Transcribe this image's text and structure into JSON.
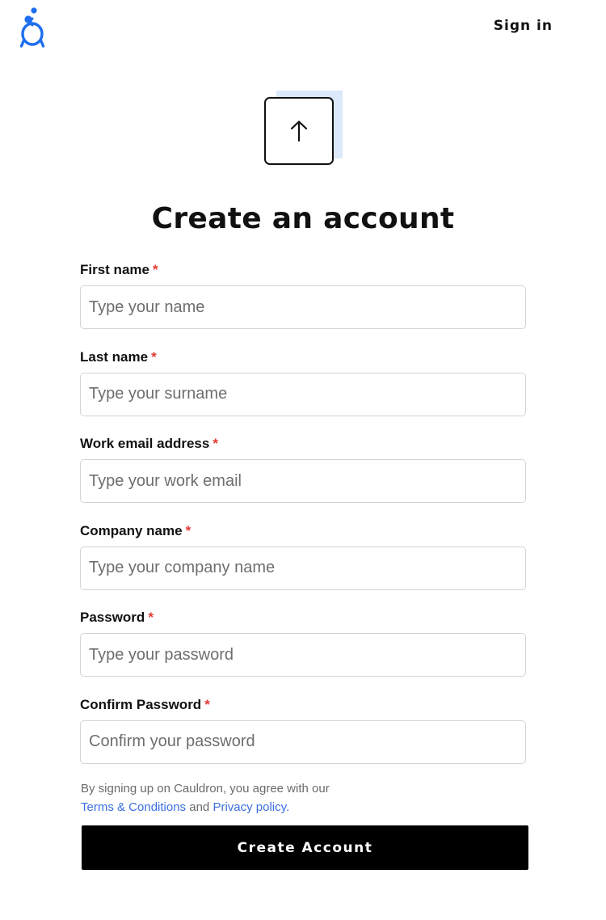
{
  "header": {
    "logo_icon": "cauldron-logo-icon",
    "brand_color": "#1e6ff0",
    "sign_in_label": "Sign in"
  },
  "upload": {
    "icon": "arrow-up-icon"
  },
  "page_title": "Create an account",
  "form": {
    "required_marker": "*",
    "required_color": "#e53935",
    "fields": [
      {
        "label": "First name",
        "placeholder": "Type your name",
        "value": ""
      },
      {
        "label": "Last name",
        "placeholder": "Type your surname",
        "value": ""
      },
      {
        "label": "Work email address",
        "placeholder": "Type your work email",
        "value": ""
      },
      {
        "label": "Company name",
        "placeholder": "Type your company name",
        "value": ""
      },
      {
        "label": "Password",
        "placeholder": "Type your password",
        "value": ""
      },
      {
        "label": "Confirm Password",
        "placeholder": "Confirm your password",
        "value": ""
      }
    ]
  },
  "terms": {
    "prefix": "By signing up on Cauldron, you agree with our",
    "terms_link": "Terms & Conditions",
    "conjunction": "and",
    "privacy_link": "Privacy policy.",
    "link_color": "#3b6fe0"
  },
  "submit_label": "Create Account"
}
